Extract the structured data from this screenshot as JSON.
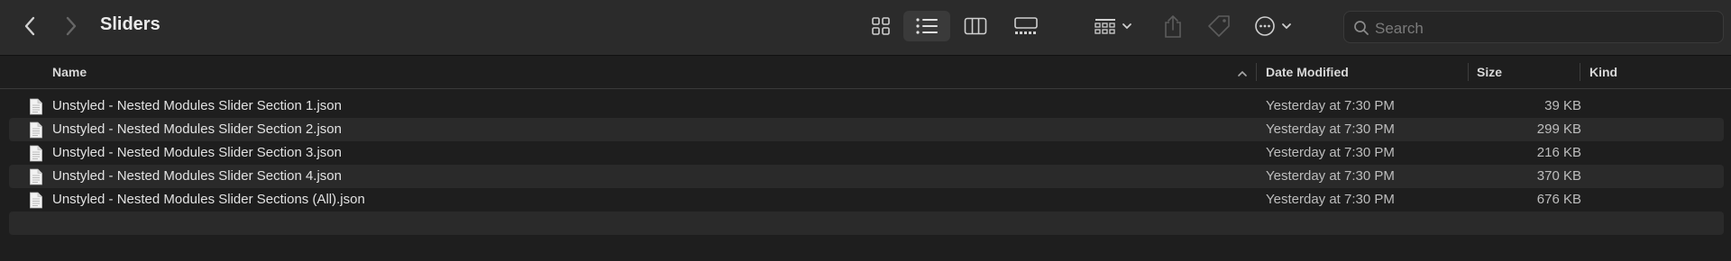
{
  "window": {
    "title": "Sliders"
  },
  "toolbar": {
    "back_icon": "chevron-left-icon",
    "forward_icon": "chevron-right-icon",
    "view_icons": [
      "grid-icon",
      "list-icon",
      "columns-icon",
      "gallery-icon"
    ],
    "active_view": "list",
    "group_icon": "group-icon",
    "share_icon": "share-icon",
    "tag_icon": "tag-icon",
    "more_icon": "more-icon"
  },
  "search": {
    "placeholder": "Search"
  },
  "columns": {
    "name": "Name",
    "date": "Date Modified",
    "size": "Size",
    "kind": "Kind",
    "sort_indicator": "^"
  },
  "files": [
    {
      "name": "Unstyled - Nested Modules Slider Section 1.json",
      "date": "Yesterday at 7:30 PM",
      "size": "39 KB",
      "kind": ""
    },
    {
      "name": "Unstyled - Nested Modules Slider Section 2.json",
      "date": "Yesterday at 7:30 PM",
      "size": "299 KB",
      "kind": ""
    },
    {
      "name": "Unstyled - Nested Modules Slider Section 3.json",
      "date": "Yesterday at 7:30 PM",
      "size": "216 KB",
      "kind": ""
    },
    {
      "name": "Unstyled - Nested Modules Slider Section 4.json",
      "date": "Yesterday at 7:30 PM",
      "size": "370 KB",
      "kind": ""
    },
    {
      "name": "Unstyled - Nested Modules Slider Sections (All).json",
      "date": "Yesterday at 7:30 PM",
      "size": "676 KB",
      "kind": ""
    }
  ],
  "colors": {
    "background": "#1e1e1e",
    "toolbar": "#2b2b2b",
    "alt_row": "#2a2a2a",
    "text": "#e2e2e2"
  }
}
